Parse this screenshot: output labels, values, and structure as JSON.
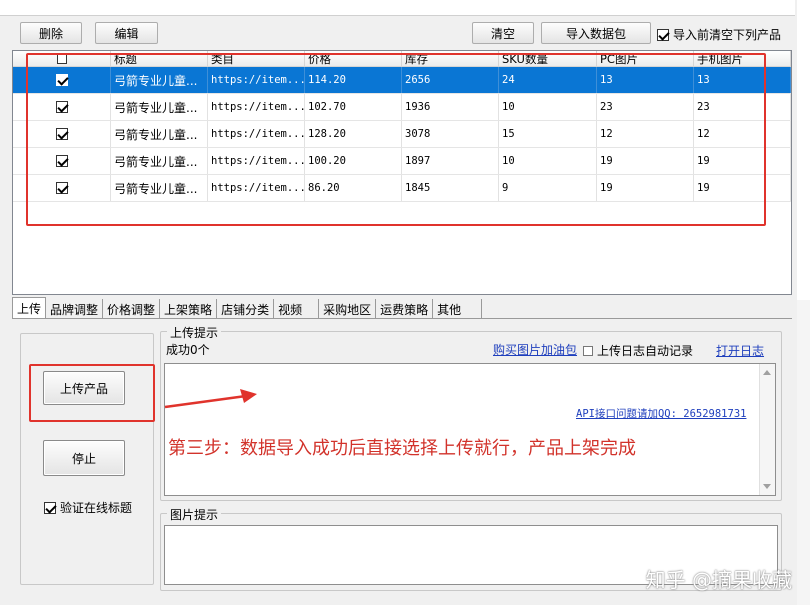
{
  "toolbar": {
    "delete_label": "删除",
    "edit_label": "编辑",
    "clear_label": "清空",
    "import_label": "导入数据包",
    "clear_before_import_label": "导入前清空下列产品",
    "clear_before_import_checked": true
  },
  "table": {
    "columns": [
      "",
      "标题",
      "类目",
      "价格",
      "库存",
      "SKU数量",
      "PC图片",
      "手机图片"
    ],
    "rows": [
      {
        "checked": true,
        "title": "弓箭专业儿童...",
        "category": "https://item...",
        "price": "114.20",
        "stock": "2656",
        "sku": "24",
        "pc": "13",
        "mobile": "13",
        "selected": true
      },
      {
        "checked": true,
        "title": "弓箭专业儿童...",
        "category": "https://item...",
        "price": "102.70",
        "stock": "1936",
        "sku": "10",
        "pc": "23",
        "mobile": "23",
        "selected": false
      },
      {
        "checked": true,
        "title": "弓箭专业儿童...",
        "category": "https://item...",
        "price": "128.20",
        "stock": "3078",
        "sku": "15",
        "pc": "12",
        "mobile": "12",
        "selected": false
      },
      {
        "checked": true,
        "title": "弓箭专业儿童...",
        "category": "https://item...",
        "price": "100.20",
        "stock": "1897",
        "sku": "10",
        "pc": "19",
        "mobile": "19",
        "selected": false
      },
      {
        "checked": true,
        "title": "弓箭专业儿童...",
        "category": "https://item...",
        "price": "86.20",
        "stock": "1845",
        "sku": "9",
        "pc": "19",
        "mobile": "19",
        "selected": false
      }
    ]
  },
  "tabs": [
    "上传",
    "品牌调整",
    "价格调整",
    "上架策略",
    "店铺分类",
    "视频",
    "采购地区",
    "运费策略",
    "其他"
  ],
  "upload_panel": {
    "upload_button": "上传产品",
    "stop_button": "停止",
    "verify_title_label": "验证在线标题",
    "verify_title_checked": true
  },
  "upload_tips": {
    "group_label": "上传提示",
    "success_text": "成功0个",
    "buy_images_link": "购买图片加油包",
    "auto_log_label": "上传日志自动记录",
    "auto_log_checked": false,
    "open_log_link": "打开日志",
    "api_contact_link": "API接口问题请加QQ: 2652981731"
  },
  "annotation": {
    "step3_text": "第三步：数据导入成功后直接选择上传就行，产品上架完成"
  },
  "image_tips": {
    "group_label": "图片提示"
  },
  "watermark": "知乎 @摘果收藏",
  "colors": {
    "selection": "#0a76d4",
    "annotation_red": "#e0332c",
    "link_blue": "#1f3fbd"
  }
}
